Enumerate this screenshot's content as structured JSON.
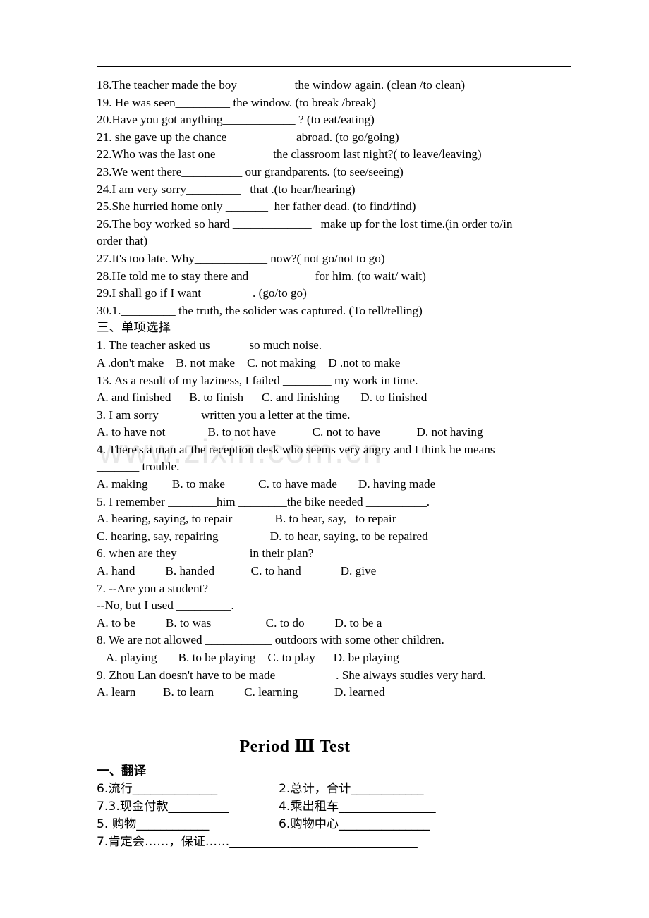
{
  "page": {
    "watermark": "www.zixin.com.cn",
    "rule_color": "#000000"
  },
  "fill_in_blanks": {
    "items": [
      "18.The teacher made the boy_________ the window again. (clean /to clean)",
      "19. He was seen_________ the window. (to break /break)",
      "20.Have you got anything____________ ? (to eat/eating)",
      "21. she gave up the chance___________ abroad. (to go/going)",
      "22.Who was the last one_________ the classroom last night?( to leave/leaving)",
      "23.We went there__________ our grandparents. (to see/seeing)",
      "24.I am very sorry_________   that .(to hear/hearing)",
      "25.She hurried home only _______  her father dead. (to find/find)",
      "26.The boy worked so hard _____________   make up for the lost time.(in order to/in",
      "order that)",
      "27.It's too late. Why____________ now?( not go/not to go)",
      "28.He told me to stay there and __________ for him. (to wait/ wait)",
      "29.I shall go if I want ________. (go/to go)",
      "30.1._________ the truth, the solider was captured. (To tell/telling)"
    ]
  },
  "multiple_choice": {
    "heading": "三、单项选择",
    "items": [
      "1. The teacher asked us ______so much noise.",
      "A .don't make    B. not make    C. not making    D .not to make",
      "13. As a result of my laziness, I failed ________ my work in time.",
      "A. and finished      B. to finish      C. and finishing       D. to finished",
      "3. I am sorry ______ written you a letter at the time.",
      "A. to have not              B. to not have            C. not to have            D. not having",
      "4. There's a man at the reception desk who seems very angry and I think he means",
      "_______ trouble.",
      "A. making        B. to make           C. to have made       D. having made",
      "5. I remember ________him ________the bike needed __________.",
      "A. hearing, saying, to repair              B. to hear, say,   to repair",
      "C. hearing, say, repairing                 D. to hear, saying, to be repaired",
      "6. when are they ___________ in their plan?",
      "A. hand          B. handed            C. to hand             D. give",
      "7. --Are you a student?",
      "--No, but I used _________.",
      "A. to be          B. to was                  C. to do          D. to be a",
      "8. We are not allowed ___________ outdoors with some other children.",
      "   A. playing       B. to be playing    C. to play      D. be playing",
      "9. Zhou Lan doesn't have to be made__________. She always studies very hard.",
      "A. learn         B. to learn          C. learning            D. learned"
    ]
  },
  "period_test": {
    "title": "Period Ⅲ        Test",
    "translation_heading": "一、翻译",
    "rows": [
      {
        "left": "6.流行______________",
        "right": "2.总计，合计____________"
      },
      {
        "left": "7.3.现金付款__________",
        "right": "4.乘出租车________________"
      },
      {
        "left": "5. 购物____________",
        "right": "6.购物中心_______________"
      }
    ],
    "last_row": "7.肯定会……，保证……_______________________________"
  }
}
